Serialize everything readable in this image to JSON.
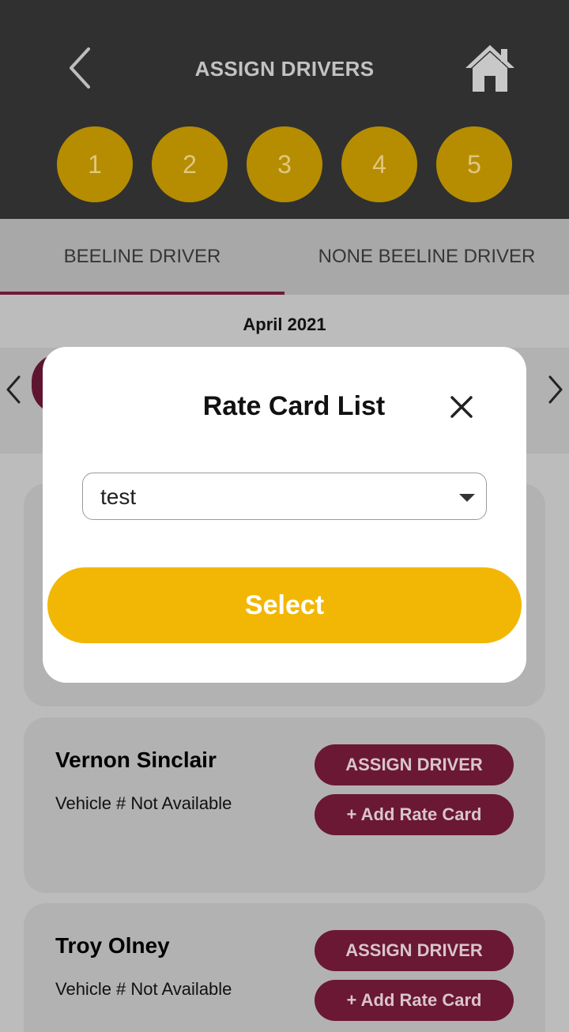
{
  "header": {
    "title": "ASSIGN DRIVERS",
    "back_icon": "chevron-left-icon",
    "home_icon": "home-icon",
    "steps": [
      "1",
      "2",
      "3",
      "4",
      "5"
    ],
    "colors": {
      "background": "#303030",
      "step": "#b68d00"
    }
  },
  "tabs": [
    {
      "label": "BEELINE DRIVER",
      "active": true
    },
    {
      "label": "NONE BEELINE DRIVER",
      "active": false
    }
  ],
  "calendar": {
    "month": "April 2021"
  },
  "drivers": [
    {
      "name": "Vernon Sinclair",
      "vehicle": "Vehicle # Not Available",
      "assign_label": "ASSIGN DRIVER",
      "rate_label": "+ Add Rate Card"
    },
    {
      "name": "Troy Olney",
      "vehicle": "Vehicle # Not Available",
      "assign_label": "ASSIGN DRIVER",
      "rate_label": "+ Add Rate Card"
    }
  ],
  "modal": {
    "title": "Rate Card List",
    "close_icon": "close-icon",
    "selected_option": "test",
    "select_label": "Select",
    "colors": {
      "button": "#f2b705",
      "accent": "#6a1834"
    }
  }
}
